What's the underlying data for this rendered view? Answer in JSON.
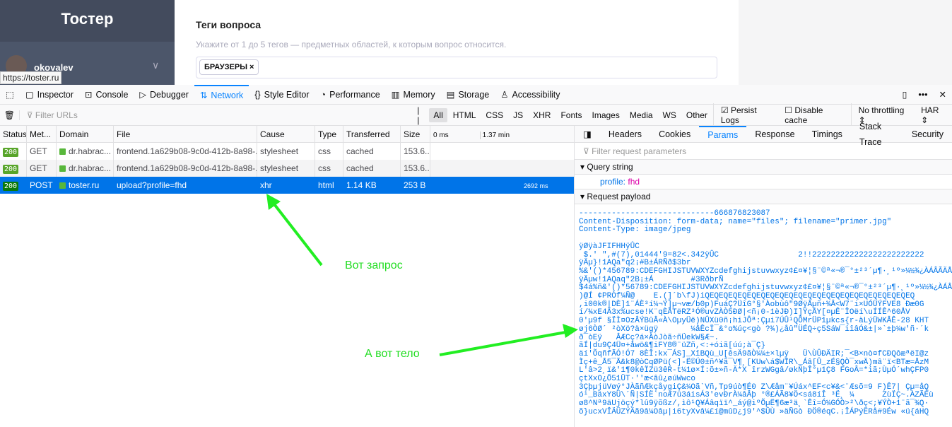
{
  "page": {
    "logo": "Тостер",
    "username": "okovalev",
    "status_url": "https://toster.ru",
    "section_title": "Теги вопроса",
    "hint": "Укажите от 1 до 5 тегов — предметных областей, к которым вопрос относится.",
    "tag": "БРАУЗЕРЫ",
    "tag_remove": "×"
  },
  "toolbar": {
    "tools": [
      "Inspector",
      "Console",
      "Debugger",
      "Network",
      "Style Editor",
      "Performance",
      "Memory",
      "Storage",
      "Accessibility"
    ],
    "active": "Network"
  },
  "filter": {
    "placeholder": "Filter URLs",
    "pause": "| |",
    "types": [
      "All",
      "HTML",
      "CSS",
      "JS",
      "XHR",
      "Fonts",
      "Images",
      "Media",
      "WS",
      "Other"
    ],
    "persist_logs": "Persist Logs",
    "persist_checked": true,
    "disable_cache": "Disable cache",
    "disable_checked": false,
    "throttling": "No throttling",
    "har": "HAR"
  },
  "table": {
    "headers": [
      "Status",
      "Met...",
      "Domain",
      "File",
      "Cause",
      "Type",
      "Transferred",
      "Size",
      "0 ms"
    ],
    "timeline_mark": "1.37 min",
    "rows": [
      {
        "status": "200",
        "method": "GET",
        "domain": "dr.habrac...",
        "file": "frontend.1a629b08-9c0d-412b-8a98-...",
        "cause": "stylesheet",
        "type": "css",
        "transferred": "cached",
        "size": "153.6...",
        "time": ""
      },
      {
        "status": "200",
        "method": "GET",
        "domain": "dr.habrac...",
        "file": "frontend.1a629b08-9c0d-412b-8a98-...",
        "cause": "stylesheet",
        "type": "css",
        "transferred": "cached",
        "size": "153.6...",
        "time": ""
      },
      {
        "status": "200",
        "method": "POST",
        "domain": "toster.ru",
        "file": "upload?profile=fhd",
        "cause": "xhr",
        "type": "html",
        "transferred": "1.14 KB",
        "size": "253 B",
        "time": "2692 ms"
      }
    ]
  },
  "panel": {
    "tabs": [
      "Headers",
      "Cookies",
      "Params",
      "Response",
      "Timings",
      "Stack Trace",
      "Security"
    ],
    "active": "Params",
    "filter_placeholder": "Filter request parameters",
    "query_title": "Query string",
    "query_key": "profile:",
    "query_value": "fhd",
    "payload_title": "Request payload",
    "payload": "-----------------------------666876823087\nContent-Disposition: form-data; name=\"files\"; filename=\"primer.jpg\"\nContent-Type: image/jpeg\n\nÿØÿàJFIFHHÿÛC\n $.' \",#(7),01444'9=82<.342ÿÛC                 2!!222222222222222222222222\nÿÄµ}!1AQa\"q2¡#B±ÁRÑð$3br\n%&'()*456789:CDEFGHIJSTUVWXYZcdefghijstuvwxyz¢£¤¥¦§¨©ª«¬­®¯°±²³´µ¶·¸¹º»¼½¾¿ÀÁÂÃÄÅÆÇÈÉÊÒÓÔÕÖ\nÿÄµw!1AQaq\"2B¡±Á        #3RðbrÑ\n$4á%ñ&'()*56789:CDEFGHIJSTUVWXYZcdefghijstuvwxyz¢£¤¥¦§¨©ª«¬­®¯°±²³´µ¶·¸¹º»¼½¾¿ÀÁÂÃÄÅÆÇÈÉÊ\n)@Í ¢PRÒf¼Ñ@    E.(]´b\\fJ)iQEQEQEQEQEQEQEQEQEQEQEQEQEQEQEQEQEQEQEQEQEQEQ\n,i00k®|DÈ]1¨ÁÈ³í¼¬Ý]µ¬væ/b0p)FuáÇ?ÜîG°§'Àobùô\"9ØÿÂµñ+¾Â<W7¨i×UÓÜÝFVE8 Ðæ0G\ní/¾xE4Ã3x%ucse!K¨qÈÅTëRZ³Ó®uvZÀÒ5ÐØ|<ñ¡0-1èJÐ)I]ÝçÅY[¤µÊ¨ÎOëí\\uÍÍÊ^60ÅV\n0'µ9f §ÏÌ¤OzÂÝBûÂ«À\\OµyÜë)NÛXü0ñ¡hiJÔª:Çµi7ÚÛ¹QÔMrÜP1µkcs{r-àLýÜWKÂÊ-28 KHT\nøj6ÒØ´ ²òXö?ä×ügÿ       ¼åÊcÏ¯&°o%úç<gò ?¾)¿åû\"ÜÉQ÷ç5SáW¯iîâÓ&±|»`±þ¼w'ñ·´k\nð¯òEÿ   ÂÆCç?á×ÀòJòã÷ñÜekW§Æ~.\nãÍ|du9Ç4Ü¤+åwö&¶iFY8®¨üZñ,<:+óiã[úú;à¯Ç}\näí'ÕqñfÃÓ!Ó7 8ÈÎ:kx¯ÁS]_XîBQù_U[êsÄ9ãÒ¼¼±×lµÿ   Ü\\ÙÛÐÄIR;¯<B×nò¤fCÐQôæªëI@z\nÌç+ê_Å5¯Ã&k8@òCqØPü(<]-Ë©Ú0±ñ^¥ã¯V¶¸[KUw\\á$WÎR\\_Áâ[Û_zÉ§QÒ¯xwÄ)mâ¨ï<BTæ=ÅzM\nL'â>2¸ï&'1¶0kêÏZü3êR-t¼1ø×Í:õ±»ñ-Ä*X îrzWGgâ/økÑþÎ°µ1Ç8 FGoÂ=*iã;ÙµÓ´whÇFP0\nçtXxO¿Ö51ÜT·''æ<âû¿øúWwco\n3ÇþµjüVøý°JÀãñÆkçåygiÇ&¼Oã`Vñ,Tp9úò¶É0 Z\\Æåm¨¥Úáx^EF<c¥&<¨Æsõ=9 F)Ê7| Çµ=åQ\nó¹_BäxY8Ü\\´Ñ|SÍË`noÆ7ü3áisÁ3'evÐrÀ¼âÂþ °®£ÁÃ8¥Ö<sá8íÎ ³Ë¸ ¼      ZùÏÇ~.ÀZÃÈù\nø8^Nª9äUjöçý*lû9ÿõßz/,ìô¹Q¥Áâqïï^_áý@iºÕµË¶6æ³ä¸`Êî=Ó¼GÓÒ>²\\ðç<;¥ÝÒ+1¨ã¯¾Q·\nõ}ucxVÎÄÜZÝÄã9â¼Oâµ|i6tyXvâ¼£í@mûD¿j9'^$ÛÙ »äÑGò ÐÖ®éqC.¡ÎÁPýËRå#9Éw «ü{áHQ"
  },
  "annotations": {
    "request": "Вот запрос",
    "body": "А вот тело",
    "color": "#22dd22"
  }
}
